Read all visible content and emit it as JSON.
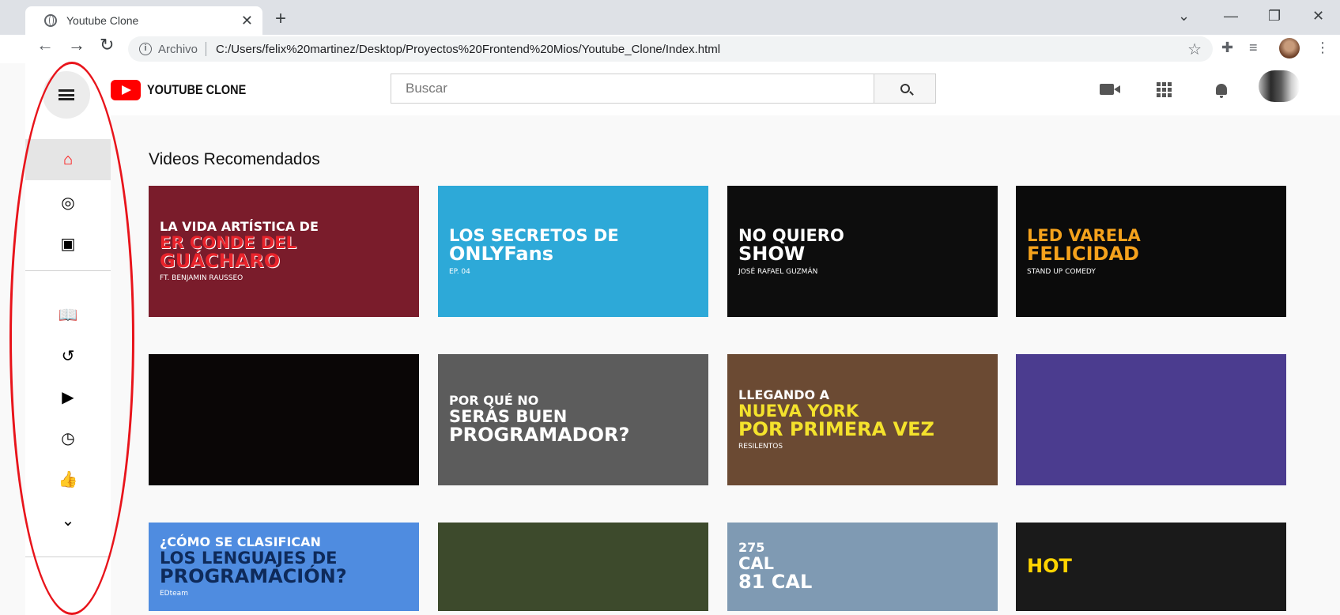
{
  "browser": {
    "tab_title": "Youtube Clone",
    "tab_close": "✕",
    "new_tab": "+",
    "controls": {
      "dropdown": "⌄",
      "minimize": "—",
      "restore": "❐",
      "close": "✕"
    },
    "address": {
      "scheme_label": "Archivo",
      "url": "C:/Users/felix%20martinez/Desktop/Proyectos%20Frontend%20Mios/Youtube_Clone/Index.html"
    }
  },
  "header": {
    "logo_text": "YOUTUBE CLONE",
    "search_placeholder": "Buscar"
  },
  "sidebar": {
    "items": [
      {
        "icon": "home-icon",
        "glyph": "⌂",
        "active": true
      },
      {
        "icon": "compass-icon",
        "glyph": "◎"
      },
      {
        "icon": "subscriptions-icon",
        "glyph": "▣"
      },
      {
        "icon": "library-icon",
        "glyph": "📖"
      },
      {
        "icon": "history-icon",
        "glyph": "↺"
      },
      {
        "icon": "play-icon",
        "glyph": "▶"
      },
      {
        "icon": "clock-icon",
        "glyph": "◷"
      },
      {
        "icon": "thumbs-up-icon",
        "glyph": "👍"
      },
      {
        "icon": "chevron-down-icon",
        "glyph": "⌄"
      }
    ]
  },
  "main": {
    "section_title": "Videos Recomendados",
    "videos": [
      {
        "lines": [
          "LA VIDA ARTÍSTICA DE",
          "ER CONDE DEL",
          "GUÁCHARO"
        ],
        "caption": "FT. BENJAMIN RAUSSEO",
        "bg": "#7a1c2b",
        "c1": "#ffffff",
        "c2": "#e8232b"
      },
      {
        "lines": [
          "",
          "LOS SECRETOS DE",
          "ONLYFans"
        ],
        "caption": "EP. 04",
        "bg": "#2da9d8",
        "c1": "#ffffff",
        "c2": "#ffffff"
      },
      {
        "lines": [
          "",
          "NO QUIERO",
          "SHOW"
        ],
        "caption": "JOSÉ RAFAEL GUZMÁN",
        "bg": "#0d0d0d",
        "c1": "#ffffff",
        "c2": "#ffffff"
      },
      {
        "lines": [
          "",
          "LED VARELA",
          "FELICIDAD"
        ],
        "caption": "STAND UP COMEDY",
        "bg": "#0b0b0b",
        "c1": "#ffffff",
        "c2": "#f5a21c"
      },
      {
        "lines": [
          "",
          "",
          ""
        ],
        "caption": "",
        "bg": "#0a0606",
        "c1": "#ffffff",
        "c2": "#ffffff"
      },
      {
        "lines": [
          "POR QUÉ NO",
          "SERÁS BUEN",
          "PROGRAMADOR?"
        ],
        "caption": "",
        "bg": "#5c5c5c",
        "c1": "#ffffff",
        "c2": "#ffffff"
      },
      {
        "lines": [
          "LLEGANDO A",
          "NUEVA YORK",
          "POR PRIMERA VEZ"
        ],
        "caption": "RESILENTOS",
        "bg": "#6b4a33",
        "c1": "#ffffff",
        "c2": "#f4e22c"
      },
      {
        "lines": [
          "",
          "",
          ""
        ],
        "caption": "",
        "bg": "#4b3c8f",
        "c1": "#ffffff",
        "c2": "#ffffff"
      },
      {
        "lines": [
          "¿CÓMO SE CLASIFICAN",
          "LOS LENGUAJES DE",
          "PROGRAMACIÓN?"
        ],
        "caption": "EDteam",
        "bg": "#4f8ce0",
        "c1": "#ffffff",
        "c2": "#0e2a5a"
      },
      {
        "lines": [
          "",
          "",
          ""
        ],
        "caption": "",
        "bg": "#3d4a2c",
        "c1": "#ffffff",
        "c2": "#ffffff"
      },
      {
        "lines": [
          "275",
          "CAL",
          "81 CAL"
        ],
        "caption": "",
        "bg": "#7f9ab3",
        "c1": "#ffffff",
        "c2": "#ffffff"
      },
      {
        "lines": [
          "",
          "",
          "HOT"
        ],
        "caption": "",
        "bg": "#1a1a1a",
        "c1": "#ffffff",
        "c2": "#ffd400"
      }
    ]
  }
}
